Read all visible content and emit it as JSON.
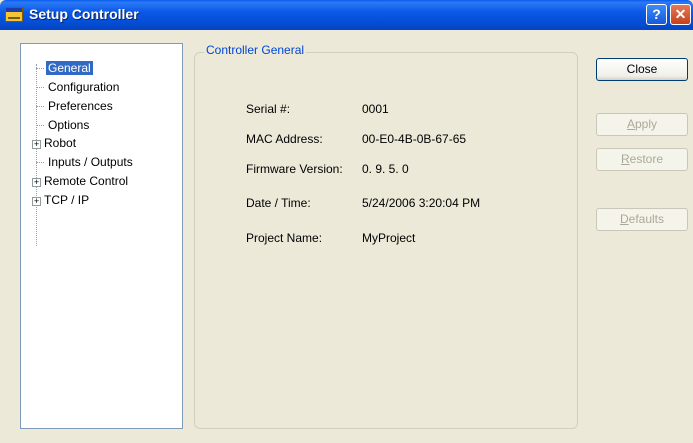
{
  "window": {
    "title": "Setup Controller",
    "help_glyph": "?",
    "close_glyph": "✕"
  },
  "tree": {
    "items": [
      {
        "label": "General",
        "selected": true
      },
      {
        "label": "Configuration"
      },
      {
        "label": "Preferences"
      },
      {
        "label": "Options"
      },
      {
        "label": "Robot",
        "expander": "+"
      },
      {
        "label": "Inputs / Outputs"
      },
      {
        "label": "Remote Control",
        "expander": "+"
      },
      {
        "label": "TCP / IP",
        "expander": "+"
      }
    ]
  },
  "group": {
    "title": "Controller General",
    "fields": [
      {
        "label": "Serial #:",
        "value": "0001"
      },
      {
        "label": "MAC Address:",
        "value": "00-E0-4B-0B-67-65"
      },
      {
        "label": "Firmware Version:",
        "value": "0. 9. 5. 0"
      },
      {
        "label": "Date / Time:",
        "value": "5/24/2006 3:20:04 PM"
      },
      {
        "label": "Project Name:",
        "value": "MyProject"
      }
    ]
  },
  "buttons": {
    "close": "Close",
    "apply": {
      "mnemonic": "A",
      "rest": "pply"
    },
    "restore": {
      "mnemonic": "R",
      "rest": "estore"
    },
    "defaults": {
      "mnemonic": "D",
      "rest": "efaults"
    }
  },
  "colors": {
    "titlebar": "#0a58e6",
    "selection": "#316ac5",
    "group_title": "#0046d5"
  }
}
